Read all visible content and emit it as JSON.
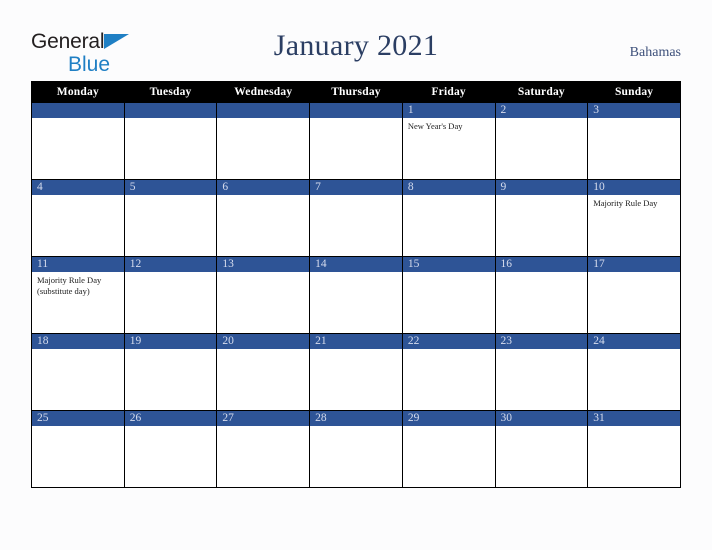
{
  "brand": {
    "line1": "General",
    "line2": "Blue",
    "triangle_color": "#1f7fc4",
    "text_color": "#231f20"
  },
  "header": {
    "title": "January 2021",
    "country": "Bahamas",
    "title_color": "#2b3e63",
    "country_color": "#3e517b"
  },
  "theme": {
    "accent_blue": "#2e5496",
    "header_bar": "#000000",
    "page_background": "#fcfcfd",
    "cell_background": "#ffffff",
    "daynum_text": "#d6dced"
  },
  "calendar": {
    "weekday_headers": [
      "Monday",
      "Tuesday",
      "Wednesday",
      "Thursday",
      "Friday",
      "Saturday",
      "Sunday"
    ],
    "weeks": [
      [
        {
          "day": "",
          "events": []
        },
        {
          "day": "",
          "events": []
        },
        {
          "day": "",
          "events": []
        },
        {
          "day": "",
          "events": []
        },
        {
          "day": "1",
          "events": [
            "New Year's Day"
          ]
        },
        {
          "day": "2",
          "events": []
        },
        {
          "day": "3",
          "events": []
        }
      ],
      [
        {
          "day": "4",
          "events": []
        },
        {
          "day": "5",
          "events": []
        },
        {
          "day": "6",
          "events": []
        },
        {
          "day": "7",
          "events": []
        },
        {
          "day": "8",
          "events": []
        },
        {
          "day": "9",
          "events": []
        },
        {
          "day": "10",
          "events": [
            "Majority Rule Day"
          ]
        }
      ],
      [
        {
          "day": "11",
          "events": [
            "Majority Rule Day (substitute day)"
          ]
        },
        {
          "day": "12",
          "events": []
        },
        {
          "day": "13",
          "events": []
        },
        {
          "day": "14",
          "events": []
        },
        {
          "day": "15",
          "events": []
        },
        {
          "day": "16",
          "events": []
        },
        {
          "day": "17",
          "events": []
        }
      ],
      [
        {
          "day": "18",
          "events": []
        },
        {
          "day": "19",
          "events": []
        },
        {
          "day": "20",
          "events": []
        },
        {
          "day": "21",
          "events": []
        },
        {
          "day": "22",
          "events": []
        },
        {
          "day": "23",
          "events": []
        },
        {
          "day": "24",
          "events": []
        }
      ],
      [
        {
          "day": "25",
          "events": []
        },
        {
          "day": "26",
          "events": []
        },
        {
          "day": "27",
          "events": []
        },
        {
          "day": "28",
          "events": []
        },
        {
          "day": "29",
          "events": []
        },
        {
          "day": "30",
          "events": []
        },
        {
          "day": "31",
          "events": []
        }
      ]
    ]
  }
}
